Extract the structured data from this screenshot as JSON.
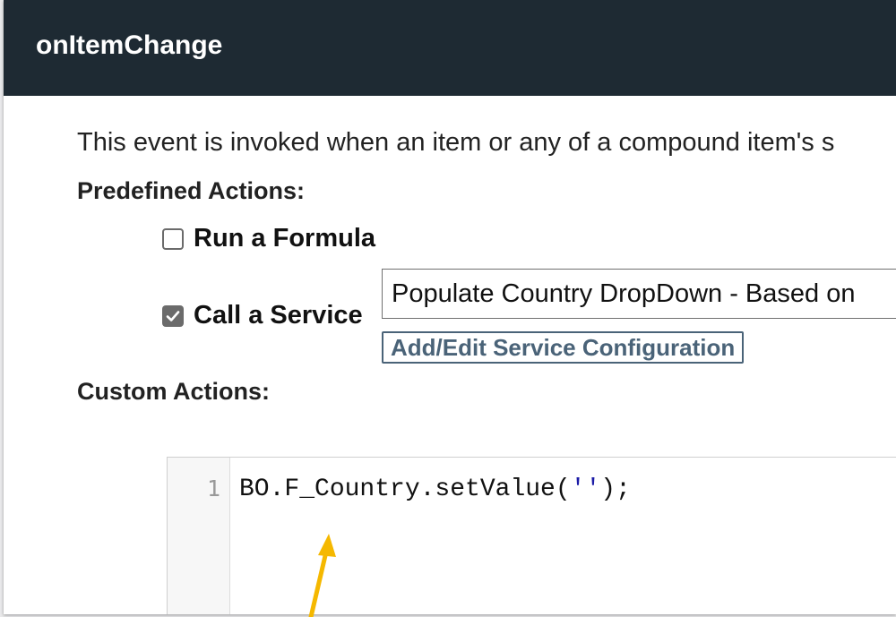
{
  "dialog": {
    "title": "onItemChange",
    "description": "This event is invoked when an item or any of a compound item's s"
  },
  "predefined": {
    "label": "Predefined Actions:",
    "run_formula": {
      "label": "Run a Formula",
      "checked": false
    },
    "call_service": {
      "label": "Call a Service",
      "checked": true
    },
    "service_select_value": "Populate Country DropDown - Based on",
    "config_link": "Add/Edit Service Configuration"
  },
  "custom": {
    "label": "Custom Actions:",
    "line_number": "1",
    "code_prefix": "BO.F_Country.setValue(",
    "code_string": "''",
    "code_suffix": ");"
  },
  "colors": {
    "titlebar": "#1e2a33",
    "link": "#4a6378",
    "checkbox": "#6b6b6b",
    "arrow": "#f5b800"
  }
}
